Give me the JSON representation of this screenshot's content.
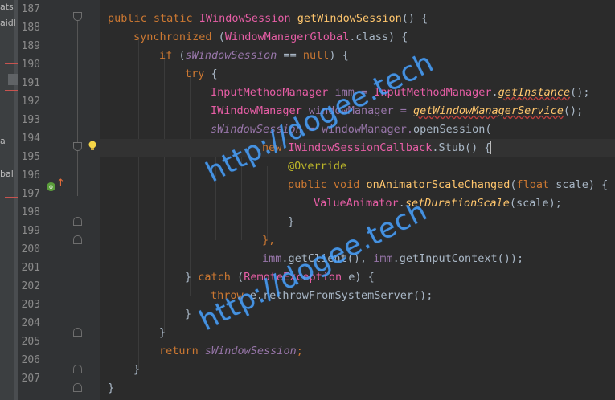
{
  "structure_panel": {
    "fragments": [
      "ats",
      "aidl",
      "a",
      "bal"
    ]
  },
  "gutter": {
    "line_numbers": [
      "187",
      "188",
      "189",
      "190",
      "191",
      "192",
      "193",
      "194",
      "195",
      "196",
      "197",
      "198",
      "199",
      "200",
      "201",
      "202",
      "203",
      "204",
      "205",
      "206",
      "207"
    ],
    "override_icon": "override-icon",
    "bulb_icon": "lightbulb-icon"
  },
  "code": {
    "l187": {
      "a": "public static ",
      "b": "IWindowSession",
      "c": " getWindowSession",
      "d": "() {"
    },
    "l188": {
      "a": "synchronized ",
      "b": "(",
      "c": "WindowManagerGlobal",
      "d": ".class) {"
    },
    "l189": {
      "a": "if ",
      "b": "(",
      "c": "sWindowSession",
      "d": " == ",
      "e": "null",
      "f": ") {"
    },
    "l190": {
      "a": "try ",
      "b": "{"
    },
    "l191": {
      "a": "InputMethodManager",
      "b": " imm = ",
      "c": "InputMethodManager",
      "d": ".",
      "e": "getInstance",
      "f": "();"
    },
    "l192": {
      "a": "IWindowManager",
      "b": " windowManager = ",
      "c": "getWindowManagerService",
      "d": "();"
    },
    "l193": {
      "a": "sWindowSession",
      "b": " = windowManager.",
      "c": "openSession",
      "d": "("
    },
    "l194": {
      "a": "new ",
      "b": "IWindowSessionCallback",
      "c": ".Stub() {"
    },
    "l195": {
      "a": "@Override"
    },
    "l196": {
      "a": "public void ",
      "b": "onAnimatorScaleChanged",
      "c": "(",
      "d": "float ",
      "e": "scale) {"
    },
    "l197": {
      "a": "ValueAnimator",
      "b": ".",
      "c": "setDurationScale",
      "d": "(scale);"
    },
    "l198": {
      "a": "}"
    },
    "l199": {
      "a": "},"
    },
    "l200": {
      "a": "imm",
      "b": ".getClient(), ",
      "c": "imm",
      "d": ".getInputContext());"
    },
    "l201": {
      "a": "} ",
      "b": "catch ",
      "c": "(",
      "d": "RemoteException",
      "e": " e) {"
    },
    "l202": {
      "a": "throw ",
      "b": "e.rethrowFromSystemServer();"
    },
    "l203": {
      "a": "}"
    },
    "l204": {
      "a": "}"
    },
    "l205": {
      "a": "return ",
      "b": "sWindowSession",
      "c": ";"
    },
    "l206": {
      "a": "}"
    },
    "l207": {
      "a": "}"
    }
  },
  "watermarks": [
    "http://dogee.tech",
    "http://dogee.tech"
  ],
  "colors": {
    "background": "#2b2b2b",
    "gutter": "#313335",
    "keyword": "#cc7832",
    "type": "#e75ea6",
    "field": "#9876aa",
    "method": "#ffc66d",
    "annotation": "#bbb529",
    "watermark": "#4aa3ff"
  }
}
